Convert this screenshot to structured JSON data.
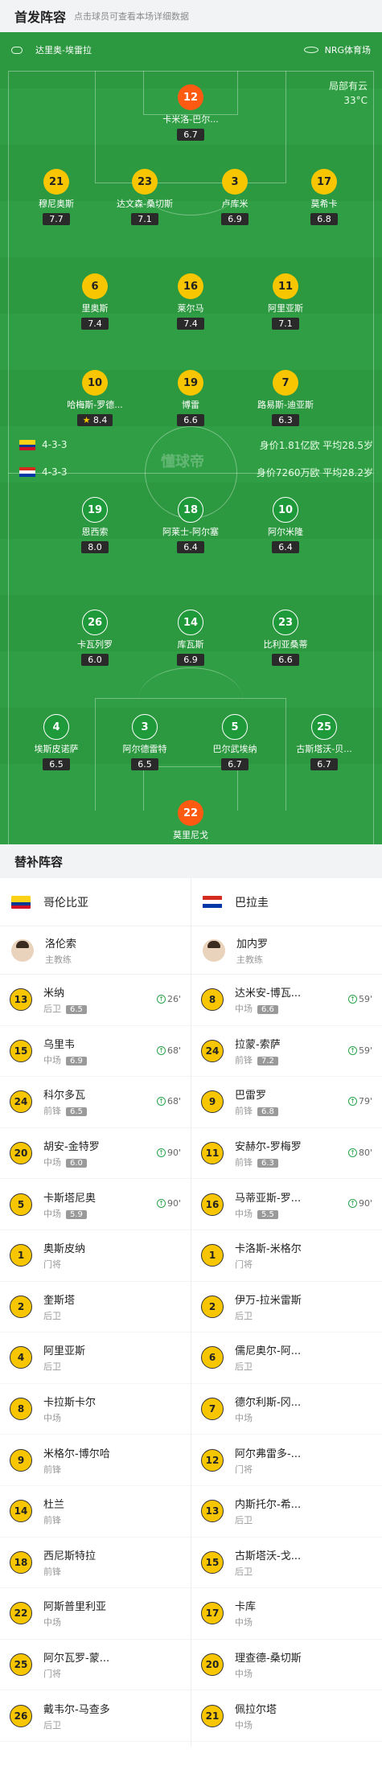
{
  "header": {
    "title": "首发阵容",
    "subtitle": "点击球员可查看本场详细数据"
  },
  "pitch": {
    "referee": "达里奥-埃雷拉",
    "broadcaster": "NRG体育场",
    "weather": "局部有云",
    "temperature": "33°C",
    "watermark": "懂球帝",
    "home_team": {
      "formation": "4-3-3",
      "value": "身价1.81亿欧  平均28.5岁",
      "flag": [
        "#fcd116",
        "#003893",
        "#ce1126"
      ]
    },
    "away_team": {
      "formation": "4-3-3",
      "value": "身价7260万欧  平均28.2岁",
      "flag": [
        "#d52b1e",
        "#ffffff",
        "#0038a8"
      ]
    }
  },
  "home_players": [
    {
      "num": "12",
      "name": "卡米洛-巴尔...",
      "rating": "6.7"
    },
    {
      "num": "21",
      "name": "穆尼奥斯",
      "rating": "7.7"
    },
    {
      "num": "23",
      "name": "达文森-桑切斯",
      "rating": "7.1"
    },
    {
      "num": "3",
      "name": "卢库米",
      "rating": "6.9",
      "sub": "26'"
    },
    {
      "num": "17",
      "name": "莫希卡",
      "rating": "6.8"
    },
    {
      "num": "6",
      "name": "里奥斯",
      "rating": "7.4"
    },
    {
      "num": "16",
      "name": "莱尔马",
      "rating": "7.4",
      "sub": "68'"
    },
    {
      "num": "11",
      "name": "阿里亚斯",
      "rating": "7.1",
      "sub": "90'"
    },
    {
      "num": "10",
      "name": "哈梅斯-罗德...",
      "rating": "8.4",
      "sub": "90'"
    },
    {
      "num": "19",
      "name": "博雷",
      "rating": "6.6",
      "sub": "68'"
    },
    {
      "num": "7",
      "name": "路易斯-迪亚斯",
      "rating": "6.3"
    }
  ],
  "away_players": [
    {
      "num": "19",
      "name": "恩西索",
      "rating": "8.0",
      "sub": "90'"
    },
    {
      "num": "18",
      "name": "阿莱士-阿尔塞",
      "rating": "6.4",
      "sub": "79'"
    },
    {
      "num": "10",
      "name": "阿尔米隆",
      "rating": "6.4",
      "sub": "59'"
    },
    {
      "num": "26",
      "name": "卡瓦列罗",
      "rating": "6.0",
      "sub": "59'"
    },
    {
      "num": "14",
      "name": "库瓦斯",
      "rating": "6.9"
    },
    {
      "num": "23",
      "name": "比利亚桑蒂",
      "rating": "6.6",
      "sub": "80'"
    },
    {
      "num": "4",
      "name": "埃斯皮诺萨",
      "rating": "6.5"
    },
    {
      "num": "3",
      "name": "阿尔德雷特",
      "rating": "6.5"
    },
    {
      "num": "5",
      "name": "巴尔武埃纳",
      "rating": "6.7"
    },
    {
      "num": "25",
      "name": "古斯塔沃-贝...",
      "rating": "6.7"
    },
    {
      "num": "22",
      "name": "莫里尼戈",
      "rating": "6.0"
    }
  ],
  "bench": {
    "title": "替补阵容",
    "home": {
      "team": "哥伦比亚",
      "coach": "洛伦索",
      "coach_role": "主教练",
      "players": [
        {
          "num": "13",
          "name": "米纳",
          "pos": "后卫",
          "rating": "6.5",
          "min": "26'"
        },
        {
          "num": "15",
          "name": "乌里韦",
          "pos": "中场",
          "rating": "6.9",
          "min": "68'"
        },
        {
          "num": "24",
          "name": "科尔多瓦",
          "pos": "前锋",
          "rating": "6.5",
          "min": "68'"
        },
        {
          "num": "20",
          "name": "胡安-金特罗",
          "pos": "中场",
          "rating": "6.0",
          "min": "90'"
        },
        {
          "num": "5",
          "name": "卡斯塔尼奥",
          "pos": "中场",
          "rating": "5.9",
          "min": "90'"
        },
        {
          "num": "1",
          "name": "奥斯皮纳",
          "pos": "门将"
        },
        {
          "num": "2",
          "name": "奎斯塔",
          "pos": "后卫"
        },
        {
          "num": "4",
          "name": "阿里亚斯",
          "pos": "后卫"
        },
        {
          "num": "8",
          "name": "卡拉斯卡尔",
          "pos": "中场"
        },
        {
          "num": "9",
          "name": "米格尔-博尔哈",
          "pos": "前锋"
        },
        {
          "num": "14",
          "name": "杜兰",
          "pos": "前锋"
        },
        {
          "num": "18",
          "name": "西尼斯特拉",
          "pos": "前锋"
        },
        {
          "num": "22",
          "name": "阿斯普里利亚",
          "pos": "中场"
        },
        {
          "num": "25",
          "name": "阿尔瓦罗-蒙...",
          "pos": "门将"
        },
        {
          "num": "26",
          "name": "戴韦尔-马查多",
          "pos": "后卫"
        }
      ]
    },
    "away": {
      "team": "巴拉圭",
      "coach": "加内罗",
      "coach_role": "主教练",
      "players": [
        {
          "num": "8",
          "name": "达米安-博瓦...",
          "pos": "中场",
          "rating": "6.6",
          "min": "59'"
        },
        {
          "num": "24",
          "name": "拉蒙-索萨",
          "pos": "前锋",
          "rating": "7.2",
          "min": "59'"
        },
        {
          "num": "9",
          "name": "巴雷罗",
          "pos": "前锋",
          "rating": "6.8",
          "min": "79'"
        },
        {
          "num": "11",
          "name": "安赫尔-罗梅罗",
          "pos": "前锋",
          "rating": "6.3",
          "min": "80'"
        },
        {
          "num": "16",
          "name": "马蒂亚斯-罗...",
          "pos": "中场",
          "rating": "5.5",
          "min": "90'"
        },
        {
          "num": "1",
          "name": "卡洛斯-米格尔",
          "pos": "门将"
        },
        {
          "num": "2",
          "name": "伊万-拉米雷斯",
          "pos": "后卫"
        },
        {
          "num": "6",
          "name": "儒尼奥尔-阿...",
          "pos": "后卫"
        },
        {
          "num": "7",
          "name": "德尔利斯-冈...",
          "pos": "中场"
        },
        {
          "num": "12",
          "name": "阿尔弗雷多-...",
          "pos": "门将"
        },
        {
          "num": "13",
          "name": "内斯托尔-希...",
          "pos": "后卫"
        },
        {
          "num": "15",
          "name": "古斯塔沃-戈...",
          "pos": "后卫"
        },
        {
          "num": "17",
          "name": "卡库",
          "pos": "中场"
        },
        {
          "num": "20",
          "name": "理查德-桑切斯",
          "pos": "中场"
        },
        {
          "num": "21",
          "name": "佩拉尔塔",
          "pos": "中场"
        }
      ]
    }
  }
}
